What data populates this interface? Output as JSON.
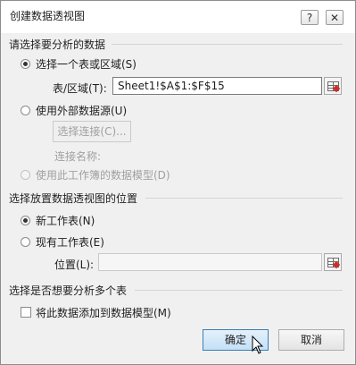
{
  "window": {
    "title": "创建数据透视图",
    "help_glyph": "?",
    "close_glyph": "✕"
  },
  "data_section": {
    "heading": "请选择要分析的数据",
    "option_table": {
      "label": "选择一个表或区域(S)",
      "checked": true
    },
    "range_label": "表/区域(T):",
    "range_value": "Sheet1!$A$1:$F$15",
    "option_external": {
      "label": "使用外部数据源(U)",
      "checked": false
    },
    "choose_connection_button": "选择连接(C)...",
    "connection_name_label": "连接名称:",
    "option_model": {
      "label": "使用此工作簿的数据模型(D)",
      "checked": false,
      "disabled": true
    }
  },
  "placement_section": {
    "heading": "选择放置数据透视图的位置",
    "option_new": {
      "label": "新工作表(N)",
      "checked": true
    },
    "option_existing": {
      "label": "现有工作表(E)",
      "checked": false
    },
    "location_label": "位置(L):",
    "location_value": ""
  },
  "multi_section": {
    "heading": "选择是否想要分析多个表",
    "add_to_model": {
      "label": "将此数据添加到数据模型(M)",
      "checked": false
    }
  },
  "buttons": {
    "ok": "确定",
    "cancel": "取消"
  },
  "icons": [
    "help-icon",
    "close-icon",
    "range-picker-icon",
    "mouse-cursor-icon"
  ]
}
